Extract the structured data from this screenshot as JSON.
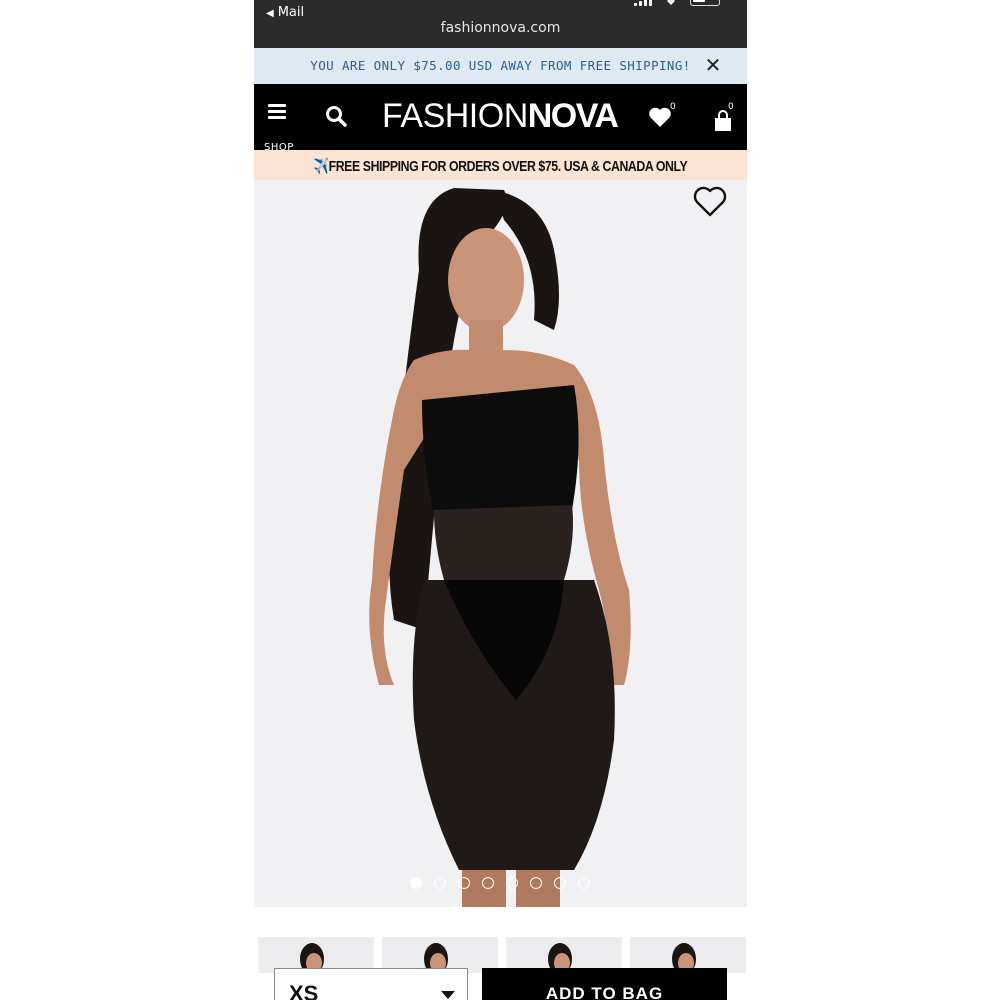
{
  "status_bar": {
    "back_label": "Mail",
    "url": "fashionnova.com"
  },
  "promo_banner": {
    "text": "YOU ARE ONLY $75.00 USD AWAY FROM FREE SHIPPING!",
    "close_icon": "close-icon"
  },
  "navbar": {
    "menu_label": "SHOP",
    "logo_light": "FASHION",
    "logo_bold": "NOVA",
    "wishlist_count": "0",
    "bag_count": "0"
  },
  "shipping_ribbon": {
    "icon": "✈️",
    "text": "FREE SHIPPING FOR ORDERS OVER $75. USA & CANADA ONLY"
  },
  "product_gallery": {
    "total_images": 8,
    "active_index": 0
  },
  "purchase": {
    "size_value": "XS",
    "add_to_bag_label": "ADD TO BAG"
  },
  "colors": {
    "navbar_bg": "#000000",
    "promo_bg": "#dfe9f2",
    "promo_text": "#2d5f8f",
    "ship_bg": "#fbe4d3"
  }
}
